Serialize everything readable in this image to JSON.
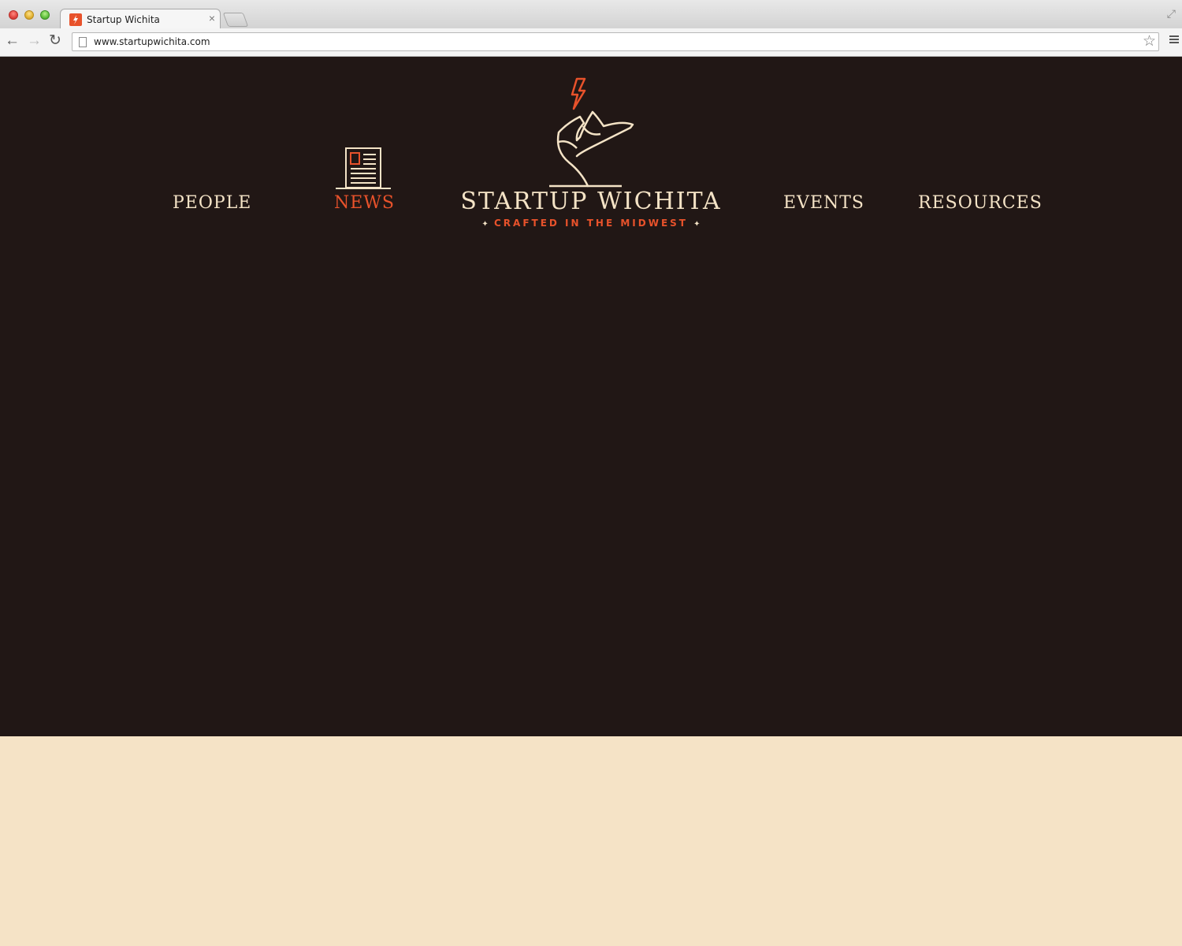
{
  "browser": {
    "tab_title": "Startup Wichita",
    "url": "www.startupwichita.com"
  },
  "nav": {
    "people": "PEOPLE",
    "news": "NEWS",
    "events": "EVENTS",
    "resources": "RESOURCES",
    "active": "NEWS"
  },
  "brand": {
    "name": "STARTUP WICHITA",
    "tagline": "CRAFTED IN THE MIDWEST"
  },
  "colors": {
    "header_bg": "#211715",
    "page_bg": "#f5e3c6",
    "cream": "#f4e3c6",
    "accent": "#e8522b"
  }
}
